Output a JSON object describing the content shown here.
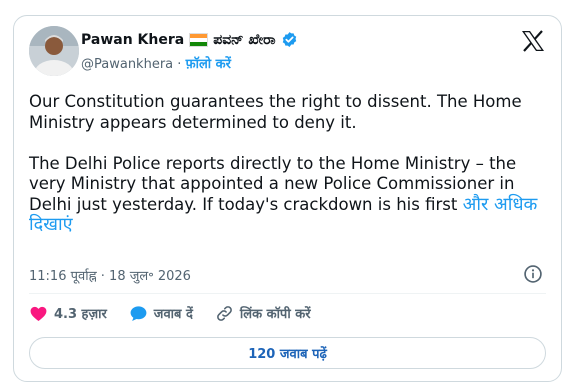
{
  "author": {
    "name": "Pawan Khera",
    "name_kannada": "ಪವನ್ ಖೇರಾ",
    "handle": "@Pawankhera",
    "separator": "·",
    "follow_label": "फ़ॉलो करें"
  },
  "tweet": {
    "text": "Our Constitution guarantees the right to dissent. The Home Ministry appears determined to deny it.\n\nThe Delhi Police reports directly to the Home Ministry – the very Ministry that appointed a new Police Commissioner in Delhi just yesterday. If today's crackdown is his first ",
    "show_more": "और अधिक दिखाएं",
    "timestamp": "11:16 पूर्वाह्न · 18 जुल॰ 2026"
  },
  "actions": {
    "likes": "4.3 हज़ार",
    "reply": "जवाब दें",
    "copy_link": "लिंक कॉपी करें"
  },
  "replies_button": "120 जवाब पढ़ें",
  "colors": {
    "accent": "#1d9bf0",
    "heart": "#f91880",
    "text_secondary": "#536471"
  },
  "icons": [
    "verified-badge-icon",
    "x-logo-icon",
    "info-icon",
    "heart-icon",
    "reply-bubble-icon",
    "link-icon"
  ]
}
